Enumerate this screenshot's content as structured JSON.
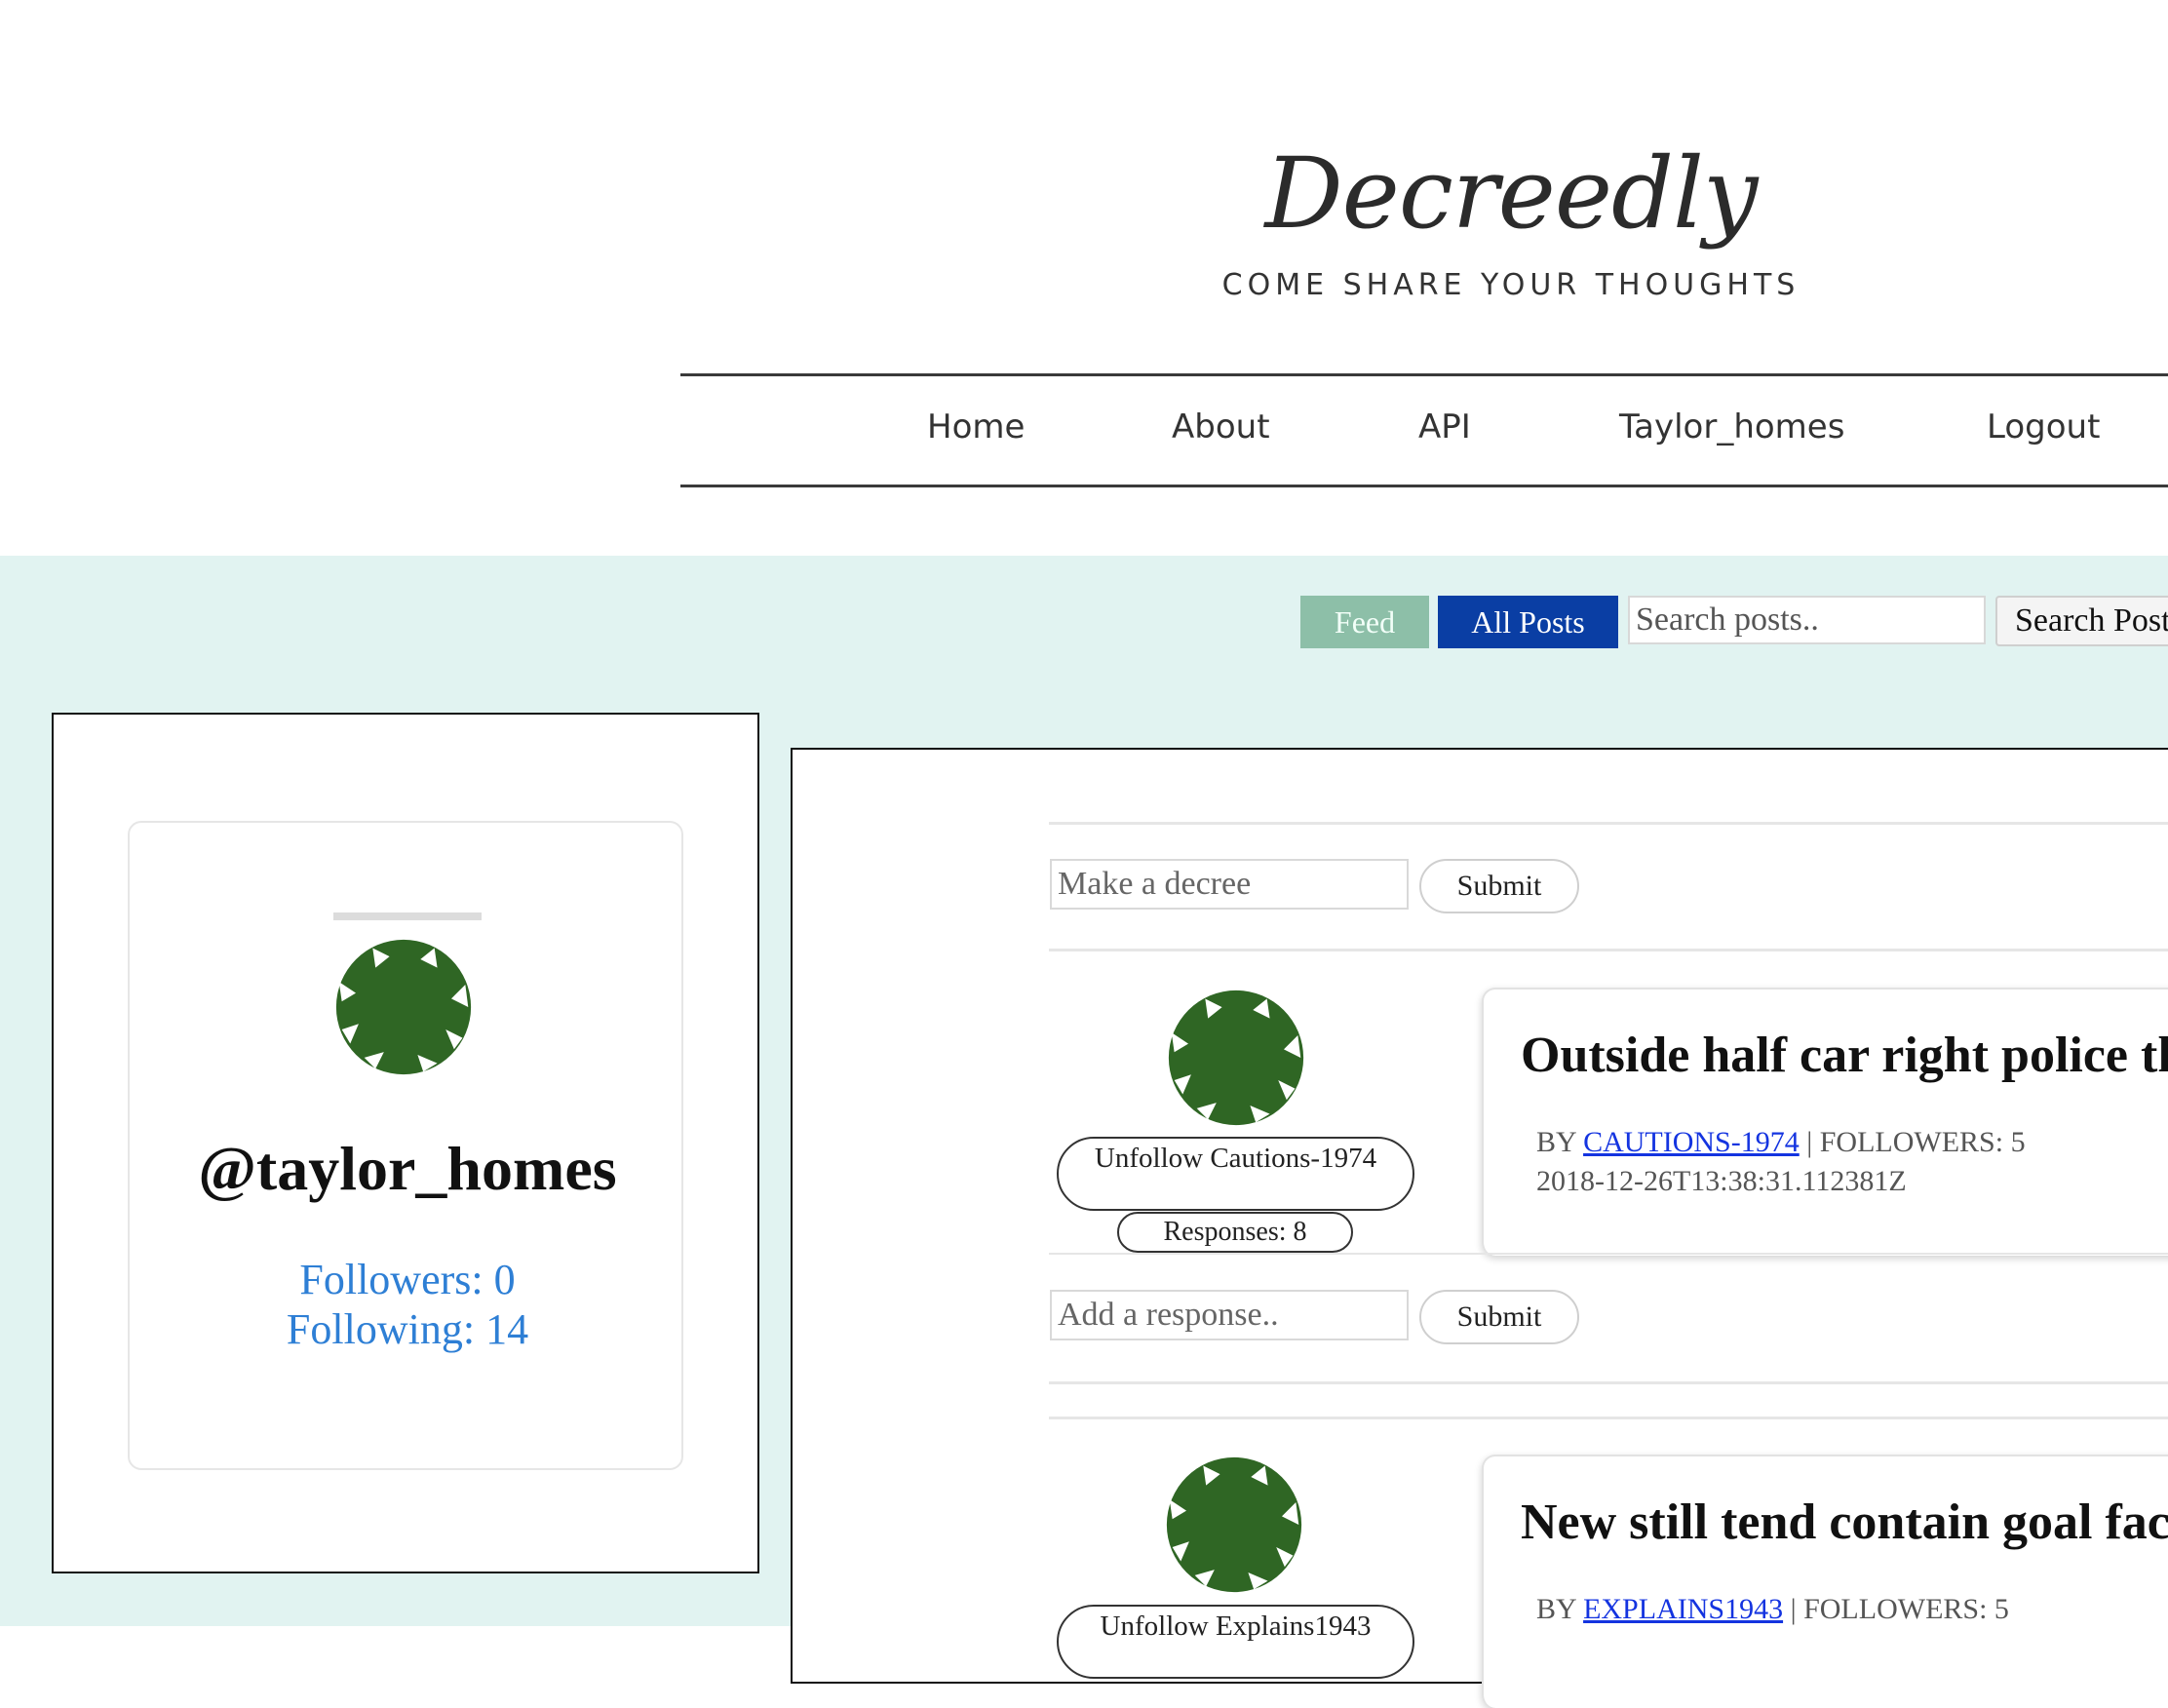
{
  "site": {
    "title": "Decreedly",
    "tagline": "COME SHARE YOUR THOUGHTS"
  },
  "nav": {
    "home": "Home",
    "about": "About",
    "api": "API",
    "user": "Taylor_homes",
    "logout": "Logout"
  },
  "toolbar": {
    "feed_tab": "Feed",
    "all_posts_tab": "All Posts",
    "search_placeholder": "Search posts..",
    "search_button": "Search Posts"
  },
  "profile": {
    "handle": "@taylor_homes",
    "followers": "Followers: 0",
    "following": "Following: 14"
  },
  "composer": {
    "placeholder": "Make a decree",
    "submit": "Submit"
  },
  "posts": [
    {
      "unfollow": "Unfollow Cautions-1974",
      "responses": "Responses: 8",
      "title": "Outside half car right police thing",
      "by": "BY",
      "author": "CAUTIONS-1974",
      "followers": "| FOLLOWERS: 5",
      "timestamp": "2018-12-26T13:38:31.112381Z",
      "response_placeholder": "Add a response..",
      "response_submit": "Submit"
    },
    {
      "unfollow": "Unfollow Explains1943",
      "title": "New still tend contain goal factor",
      "by": "BY",
      "author": "EXPLAINS1943",
      "followers": "| FOLLOWERS: 5"
    }
  ],
  "colors": {
    "band_background": "#e1f3f1",
    "feed_tab": "#8dbfa8",
    "all_posts_tab": "#0a3ea4",
    "avatar_green": "#2f6624",
    "link_blue": "#2e7fd5",
    "author_link": "#1434e0"
  },
  "icons": {
    "avatar": "green-asterisk-avatar-icon"
  }
}
